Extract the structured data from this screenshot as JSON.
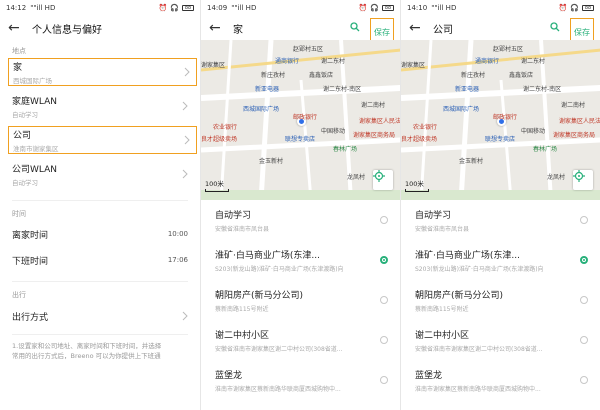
{
  "accent_color": "#27b07a",
  "highlight_color": "#f0a020",
  "panel1": {
    "status": {
      "time": "14:12",
      "signal": "\"\"ill HD",
      "battery": "88"
    },
    "title": "个人信息与偏好",
    "section_place": "地点",
    "rows": [
      {
        "label": "家",
        "sub": "西城国际广场"
      },
      {
        "label": "家庭WLAN",
        "sub": "自动学习"
      },
      {
        "label": "公司",
        "sub": "淮南市谢家集区"
      },
      {
        "label": "公司WLAN",
        "sub": "自动学习"
      }
    ],
    "section_time": "时间",
    "leave_home": {
      "label": "离家时间",
      "value": "10:00"
    },
    "off_work": {
      "label": "下班时间",
      "value": "17:06"
    },
    "section_travel": "出行",
    "travel_mode": {
      "label": "出行方式"
    },
    "footnote_1": "1.设置家和公司地址、离家时间和下班时间，并选择",
    "footnote_2": "常用的出行方式后，Breeno 可以为你提供上下班通"
  },
  "panel2": {
    "status": {
      "time": "14:09",
      "signal": "\"\"ill HD",
      "battery": "88"
    },
    "title": "家",
    "save": "保存"
  },
  "panel3": {
    "status": {
      "time": "14:10",
      "signal": "\"\"ill HD",
      "battery": "88"
    },
    "title": "公司",
    "save": "保存"
  },
  "map": {
    "pois": [
      "赵郢村五区",
      "通商银行",
      "谢二东村",
      "新庄孜村",
      "新亚电器",
      "鑫鑫饭店",
      "谢二东村-南区",
      "西城国际广场",
      "谢二南村",
      "谢家集区人民法院",
      "谢家集区商务局",
      "邮政银行",
      "中国移动",
      "联想专卖店",
      "春林广场",
      "金玉新村",
      "良才超级卖场",
      "农业银行",
      "谢家集区",
      "龙凤村"
    ],
    "scale": "100米"
  },
  "places": [
    {
      "name": "自动学习",
      "addr": "安徽省淮南市凤台县"
    },
    {
      "name": "淮矿·白马商业广场(东津...",
      "addr": "S203(新龙山路)淮矿·白马商业广场(东津渡路)向"
    },
    {
      "name": "朝阳房产(新马分公司)",
      "addr": "蔡新南路115号附近"
    },
    {
      "name": "谢二中村小区",
      "addr": "安徽省淮南市谢家集区谢二中村公司(308省道..."
    },
    {
      "name": "蓝堡龙",
      "addr": "淮南市谢家集区蔡新南路华联商厦西城购物中..."
    }
  ],
  "selected_index": 1
}
